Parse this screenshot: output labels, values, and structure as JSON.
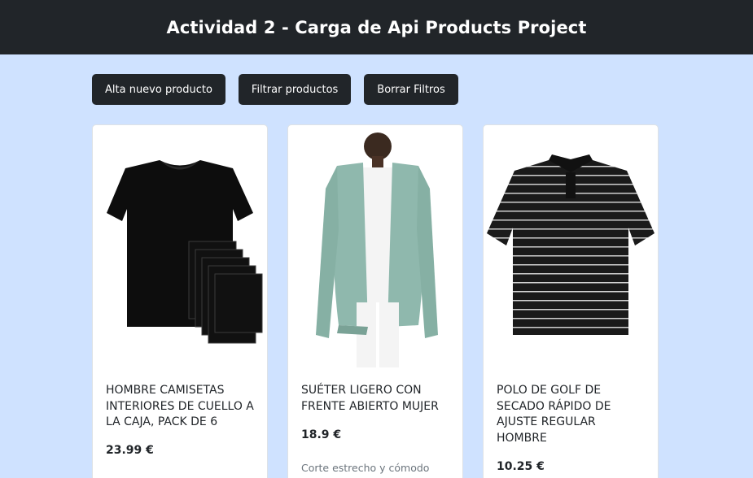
{
  "header": {
    "title": "Actividad 2 - Carga de Api Products Project"
  },
  "toolbar": {
    "add_label": "Alta nuevo producto",
    "filter_label": "Filtrar productos",
    "clear_label": "Borrar Filtros"
  },
  "products": [
    {
      "title": "Hombre Camisetas interiores de cuello a la caja, Pack de 6",
      "price": "23.99 €",
      "image": "black-tshirt-pack"
    },
    {
      "title": "Suéter ligero con frente abierto mujer",
      "price": "18.9 €",
      "description": "Corte estrecho y cómodo",
      "image": "green-cardigan"
    },
    {
      "title": "Polo de golf de secado rápido de ajuste regular hombre",
      "price": "10.25 €",
      "image": "striped-polo"
    }
  ],
  "colors": {
    "header_bg": "#212529",
    "page_bg": "#cfe2ff",
    "button_bg": "#212529",
    "card_bg": "#ffffff"
  }
}
